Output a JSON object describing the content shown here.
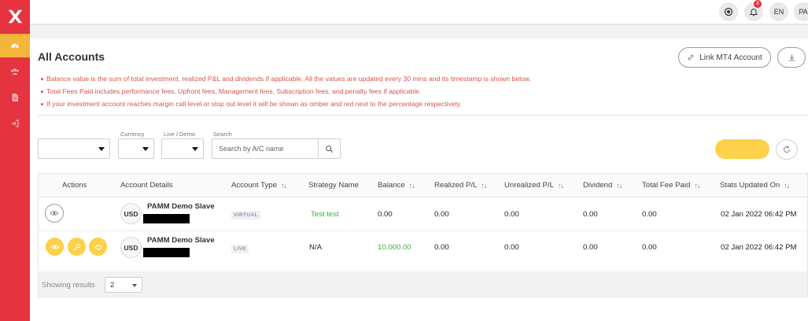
{
  "topbar": {
    "notification_count": "8",
    "language": "EN",
    "user_initials": "PA"
  },
  "page": {
    "title": "All Accounts",
    "link_button": "Link MT4 Account",
    "notes": [
      "Balance value is the sum of total investment, realized P&L and dividends if applicable. All the values are updated every 30 mins and its timestamp is shown below.",
      "Total Fees Paid includes performance fees, Upfront fees, Management fees, Subscription fees, and penalty fees if applicable.",
      "If your investment account reaches margin call level or stop out level it will be shown as omber and red next to the percentage respectively."
    ]
  },
  "filters": {
    "currency_label": "Currency",
    "live_demo_label": "Live / Demo",
    "search_label": "Search",
    "search_placeholder": "Search by A/C name"
  },
  "table": {
    "headers": {
      "actions": "Actions",
      "account_details": "Account Details",
      "account_type": "Account Type",
      "strategy_name": "Strategy Name",
      "balance": "Balance",
      "realized_pl": "Realized P/L",
      "unrealized_pl": "Unrealized P/L",
      "dividend": "Dividend",
      "total_fee_paid": "Total Fee Paid",
      "stats_updated_on": "Stats Updated On"
    },
    "sort_glyph": "↑↓",
    "rows": [
      {
        "currency": "USD",
        "name": "PAMM Demo Slave",
        "type": "VIRTUAL",
        "strategy": "Test test",
        "balance": "0.00",
        "realized": "0.00",
        "unrealized": "0.00",
        "dividend": "0.00",
        "fee": "0.00",
        "updated": "02 Jan 2022 06:42 PM"
      },
      {
        "currency": "USD",
        "name": "PAMM Demo Slave",
        "type": "LIVE",
        "strategy": "N/A",
        "balance": "10,000.00",
        "realized": "0.00",
        "unrealized": "0.00",
        "dividend": "0.00",
        "fee": "0.00",
        "updated": "02 Jan 2022 06:42 PM"
      }
    ]
  },
  "pagination": {
    "showing_label": "Showing results",
    "page_size": "2"
  },
  "colors": {
    "sidebar": "#e5333f",
    "accent_yellow": "#fdd24a",
    "note_red": "#d9534f",
    "positive_green": "#3fae3f"
  }
}
